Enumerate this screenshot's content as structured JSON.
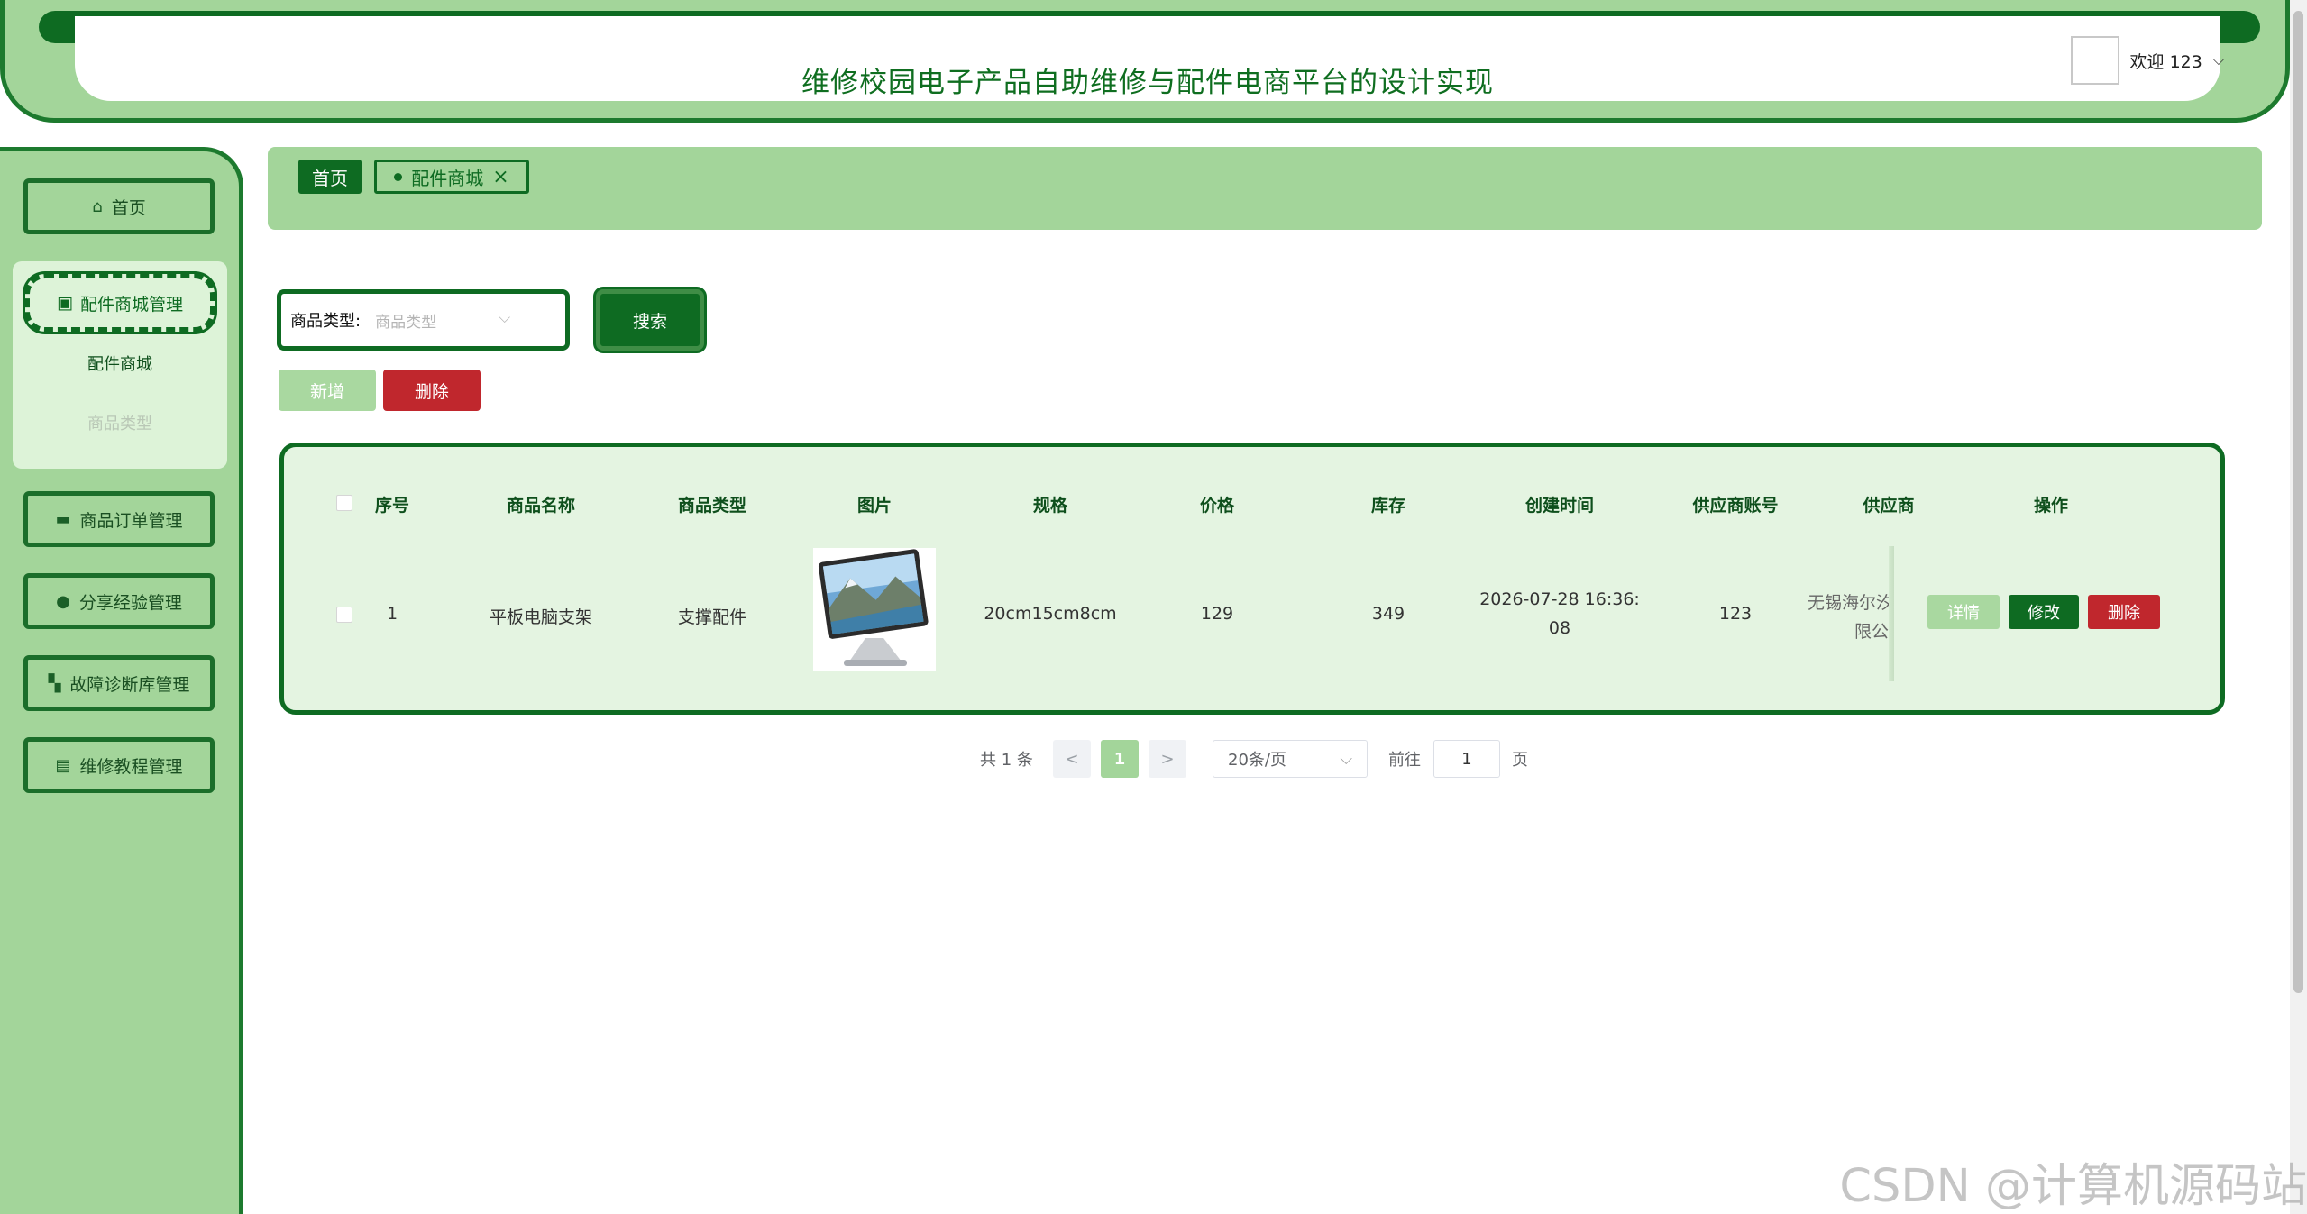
{
  "header": {
    "title": "维修校园电子产品自助维修与配件电商平台的设计实现",
    "welcome": "欢迎 123",
    "dropdown_icon": "chevron-down-icon"
  },
  "sidebar": {
    "items": [
      {
        "label": "首页",
        "icon": "home-icon"
      },
      {
        "label": "配件商城管理",
        "icon": "chip-icon",
        "active": true
      },
      {
        "label": "商品订单管理",
        "icon": "card-icon"
      },
      {
        "label": "分享经验管理",
        "icon": "check-circle-icon"
      },
      {
        "label": "故障诊断库管理",
        "icon": "cart-icon"
      },
      {
        "label": "维修教程管理",
        "icon": "id-card-icon"
      }
    ],
    "submenu": [
      {
        "label": "配件商城"
      },
      {
        "label": "商品类型"
      }
    ]
  },
  "breadcrumb": {
    "home": "首页",
    "current_tab": "配件商城",
    "close": "×"
  },
  "search": {
    "label": "商品类型:",
    "placeholder": "商品类型",
    "button": "搜索"
  },
  "actions": {
    "add": "新增",
    "delete": "删除"
  },
  "table": {
    "headers": [
      "序号",
      "商品名称",
      "商品类型",
      "图片",
      "规格",
      "价格",
      "库存",
      "创建时间",
      "供应商账号",
      "供应商",
      "操作"
    ],
    "rows": [
      {
        "index": "1",
        "name": "平板电脑支架",
        "type": "支撑配件",
        "spec": "20cm15cm8cm",
        "price": "129",
        "stock": "349",
        "created_line1": "2026-07-28 16:36:",
        "created_line2": "08",
        "supplier_account": "123",
        "supplier_line1": "无锡海尔汐",
        "supplier_line2": "限公",
        "ops": {
          "detail": "详情",
          "edit": "修改",
          "delete": "删除"
        }
      }
    ]
  },
  "pagination": {
    "total": "共 1 条",
    "prev": "<",
    "current": "1",
    "next": ">",
    "page_size": "20条/页",
    "goto_label": "前往",
    "goto_value": "1",
    "page_suffix": "页"
  },
  "watermark": "CSDN @计算机源码站",
  "colors": {
    "primary": "#0e6b22",
    "light": "#a3d59a",
    "pale": "#e4f4e1",
    "danger": "#c0272d"
  }
}
